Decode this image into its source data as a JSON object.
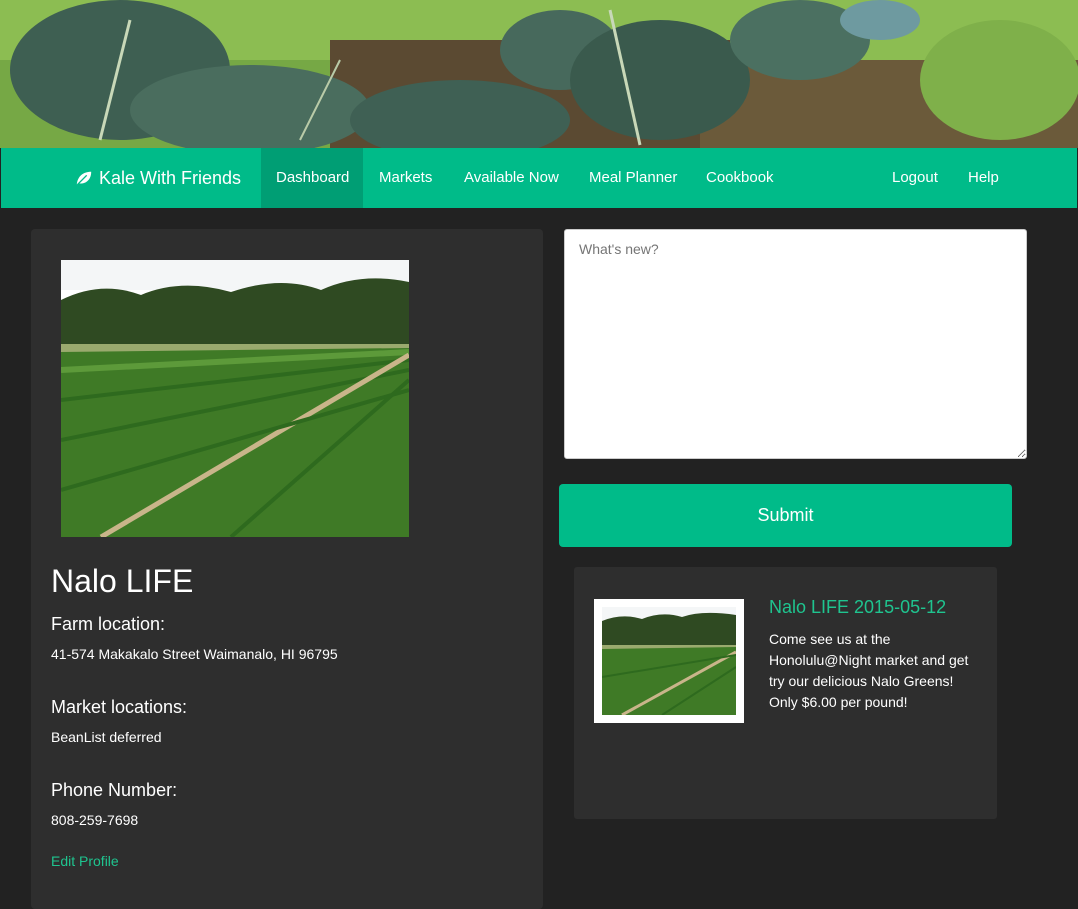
{
  "nav": {
    "brand": "Kale With Friends",
    "items": [
      {
        "label": "Dashboard",
        "active": true
      },
      {
        "label": "Markets",
        "active": false
      },
      {
        "label": "Available Now",
        "active": false
      },
      {
        "label": "Meal Planner",
        "active": false
      },
      {
        "label": "Cookbook",
        "active": false
      }
    ],
    "right_items": [
      {
        "label": "Logout"
      },
      {
        "label": "Help"
      }
    ]
  },
  "profile": {
    "farm_name": "Nalo LIFE",
    "farm_location_label": "Farm location:",
    "farm_location": "41-574 Makakalo Street Waimanalo, HI 96795",
    "market_locations_label": "Market locations:",
    "market_locations": "BeanList deferred",
    "phone_label": "Phone Number:",
    "phone": "808-259-7698",
    "edit_link": "Edit Profile"
  },
  "composer": {
    "placeholder": "What's new?",
    "submit_label": "Submit"
  },
  "post": {
    "title": "Nalo LIFE 2015-05-12",
    "body": "Come see us at the Honolulu@Night market and get try our delicious Nalo Greens! Only $6.00 per pound!"
  },
  "colors": {
    "accent": "#00bb89",
    "accent_dark": "#009e74",
    "link": "#1fc48f",
    "panel": "#2e2e2e",
    "page_bg": "#222222"
  },
  "icons": {
    "brand_icon": "leaf-icon"
  }
}
